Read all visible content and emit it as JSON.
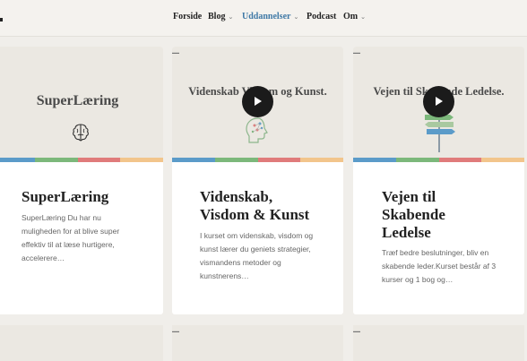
{
  "nav": {
    "items": [
      {
        "label": "Forside",
        "has_dropdown": false,
        "active": false
      },
      {
        "label": "Blog",
        "has_dropdown": true,
        "active": false
      },
      {
        "label": "Uddannelser",
        "has_dropdown": true,
        "active": true
      },
      {
        "label": "Podcast",
        "has_dropdown": false,
        "active": false
      },
      {
        "label": "Om",
        "has_dropdown": true,
        "active": false
      }
    ],
    "dropdown_glyph": "⌄"
  },
  "cards": [
    {
      "thumb_title": "SuperLæring",
      "title": "SuperLæring",
      "excerpt": "SuperLæring Du har nu muligheden for at blive super effektiv til at læse hurtigere, accelerere…",
      "icon": "brain-icon",
      "has_video": false
    },
    {
      "thumb_title": "Videnskab Visdom og Kunst.",
      "title": "Videnskab, Visdom & Kunst",
      "excerpt": "I kurset om videnskab, visdom og kunst lærer du geniets strategier, vismandens metoder og kunstnerens…",
      "icon": "head-network-icon",
      "has_video": true
    },
    {
      "thumb_title": "Vejen til Skabende Ledelse.",
      "title": "Vejen til Skabende Ledelse",
      "excerpt": "Træf bedre beslutninger, bliv en skabende leder.Kurset består af 3 kurser og 1 bog og…",
      "icon": "signpost-icon",
      "has_video": true
    }
  ],
  "colors": {
    "page_bg": "#f0eeea",
    "card_bg": "#ffffff",
    "thumb_bg": "#ebe8e2",
    "nav_active": "#3f79a6",
    "stripe": [
      "#5b9bc9",
      "#7cb87b",
      "#e07b7b",
      "#f2c58c"
    ]
  }
}
